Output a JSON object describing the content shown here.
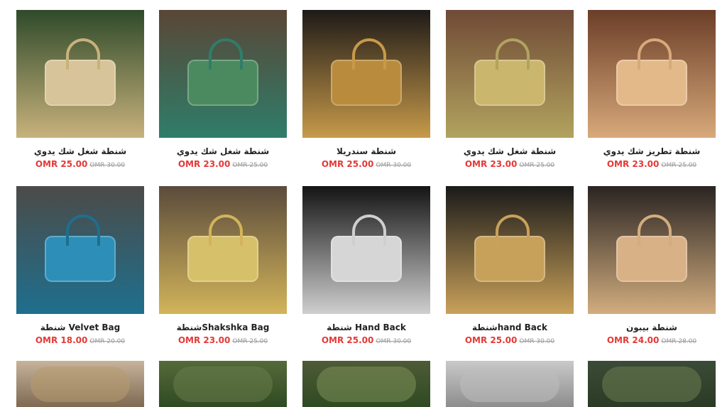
{
  "products": [
    {
      "title": "شنطة شغل شك يدوي",
      "price": "OMR 25.00",
      "old_price": "OMR 30.00",
      "palette": {
        "bg": "#2f4a2a",
        "accent": "#c8b27c",
        "item": "#d8c49a"
      }
    },
    {
      "title": "شنطة شغل شك يدوي",
      "price": "OMR 23.00",
      "old_price": "OMR 25.00",
      "palette": {
        "bg": "#5a4636",
        "accent": "#2f7d6a",
        "item": "#4b8a5f"
      }
    },
    {
      "title": "شنطة سندريلا",
      "price": "OMR 25.00",
      "old_price": "OMR 30.00",
      "palette": {
        "bg": "#1e1a18",
        "accent": "#c79a4a",
        "item": "#b98b3c"
      }
    },
    {
      "title": "شنطة شغل شك يدوي",
      "price": "OMR 23.00",
      "old_price": "OMR 25.00",
      "palette": {
        "bg": "#6f4a36",
        "accent": "#b2a35f",
        "item": "#cbb66d"
      }
    },
    {
      "title": "شنطة تطريز شك يدوي",
      "price": "OMR 23.00",
      "old_price": "OMR 25.00",
      "palette": {
        "bg": "#6b3e28",
        "accent": "#d8a97a",
        "item": "#e4b98a"
      }
    },
    {
      "title": "Velvet Bag شنطة",
      "price": "OMR 18.00",
      "old_price": "OMR 20.00",
      "palette": {
        "bg": "#4c4b48",
        "accent": "#1e6f8e",
        "item": "#2d8fb8"
      }
    },
    {
      "title": "Shakshka Bagشنطة",
      "price": "OMR 23.00",
      "old_price": "OMR 25.00",
      "palette": {
        "bg": "#5b4b3c",
        "accent": "#d2b45a",
        "item": "#d7c06a"
      }
    },
    {
      "title": "Hand Back شنطة",
      "price": "OMR 25.00",
      "old_price": "OMR 30.00",
      "palette": {
        "bg": "#141414",
        "accent": "#cfcfcf",
        "item": "#d6d6d6"
      }
    },
    {
      "title": "hand Backشنطة",
      "price": "OMR 25.00",
      "old_price": "OMR 30.00",
      "palette": {
        "bg": "#1a1a1a",
        "accent": "#c9a15a",
        "item": "#c7a15a"
      }
    },
    {
      "title": "شنطة بيبون",
      "price": "OMR 24.00",
      "old_price": "OMR 28.00",
      "palette": {
        "bg": "#2a2422",
        "accent": "#d2ad7f",
        "item": "#d8b187"
      }
    }
  ],
  "partial_row": [
    {
      "palette": {
        "bg": "#c7b39c",
        "accent": "#7e6a52",
        "item": "#b89b6e"
      }
    },
    {
      "palette": {
        "bg": "#556a3a",
        "accent": "#2f4a22",
        "item": "#6a7b4b"
      }
    },
    {
      "palette": {
        "bg": "#4e5b37",
        "accent": "#2f4a22",
        "item": "#7e8f57"
      }
    },
    {
      "palette": {
        "bg": "#c9c9c9",
        "accent": "#8d8d8d",
        "item": "#bdbdbd"
      }
    },
    {
      "palette": {
        "bg": "#3a4b37",
        "accent": "#2b3a24",
        "item": "#6b7e52"
      }
    }
  ]
}
